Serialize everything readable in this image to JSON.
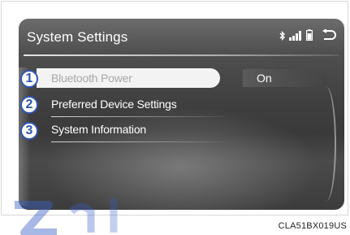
{
  "header": {
    "title": "System Settings",
    "icons": [
      "bluetooth-icon",
      "signal-strength-icon",
      "battery-icon",
      "back-icon"
    ]
  },
  "menu": {
    "items": [
      {
        "number": "1",
        "label": "Bluetooth Power",
        "value": "On",
        "selected": true
      },
      {
        "number": "2",
        "label": "Preferred Device Settings"
      },
      {
        "number": "3",
        "label": "System Information"
      }
    ]
  },
  "footer": {
    "image_code": "CLA51BX019US"
  },
  "colors": {
    "callout": "#2f55b6",
    "screen_bg": "#4a4a4a",
    "selected_item_bg": "#f3f3f3"
  }
}
